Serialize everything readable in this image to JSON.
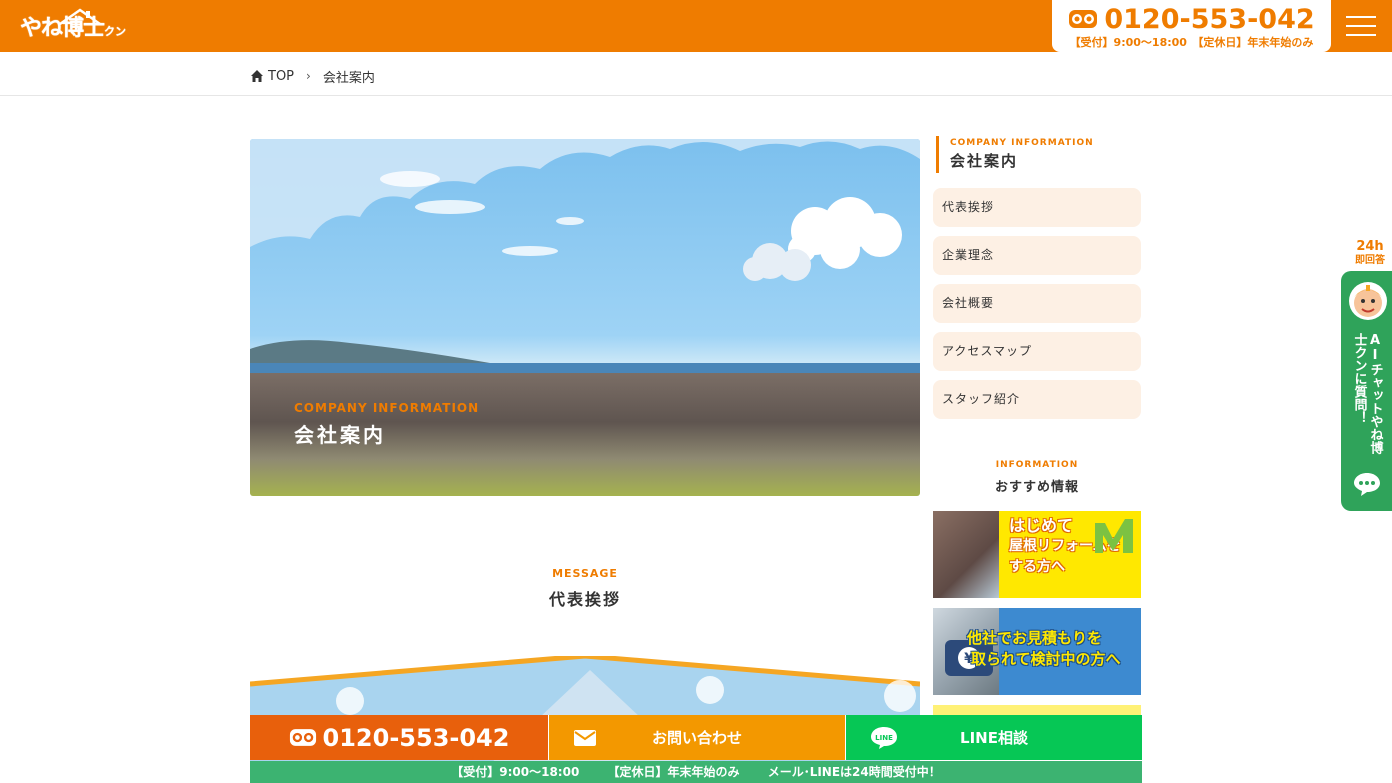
{
  "header": {
    "logo_text": "やね博士",
    "logo_sub": "クン",
    "phone": "0120-553-042",
    "hours": "【受付】9:00～18:00　【定休日】年末年始のみ"
  },
  "breadcrumb": {
    "home": "TOP",
    "current": "会社案内"
  },
  "hero": {
    "en": "COMPANY INFORMATION",
    "ja": "会社案内"
  },
  "message": {
    "en": "MESSAGE",
    "ja": "代表挨拶"
  },
  "sidebar": {
    "en": "COMPANY INFORMATION",
    "ja": "会社案内",
    "items": [
      {
        "label": "代表挨拶"
      },
      {
        "label": "企業理念"
      },
      {
        "label": "会社概要"
      },
      {
        "label": "アクセスマップ"
      },
      {
        "label": "スタッフ紹介"
      }
    ],
    "info_en": "INFORMATION",
    "info_ja": "おすすめ情報",
    "banners": [
      {
        "line1": "はじめて",
        "line2": "屋根リフォームを",
        "line3": "する方へ"
      },
      {
        "line1": "他社でお見積もりを",
        "line2": "取られて検討中の方へ"
      }
    ]
  },
  "chat": {
    "hours": "24h",
    "reply": "即回答",
    "label": "AIチャットやね博士クンに質問！"
  },
  "bottom": {
    "tel": "0120-553-042",
    "mail": "お問い合わせ",
    "line": "LINE相談",
    "info1": "【受付】9:00～18:00",
    "info2": "【定休日】年末年始のみ",
    "info3": "メール･LINEは24時間受付中！"
  },
  "colors": {
    "brand_orange": "#ef7c00",
    "line_green": "#06c755",
    "chat_green": "#2fa35a"
  }
}
